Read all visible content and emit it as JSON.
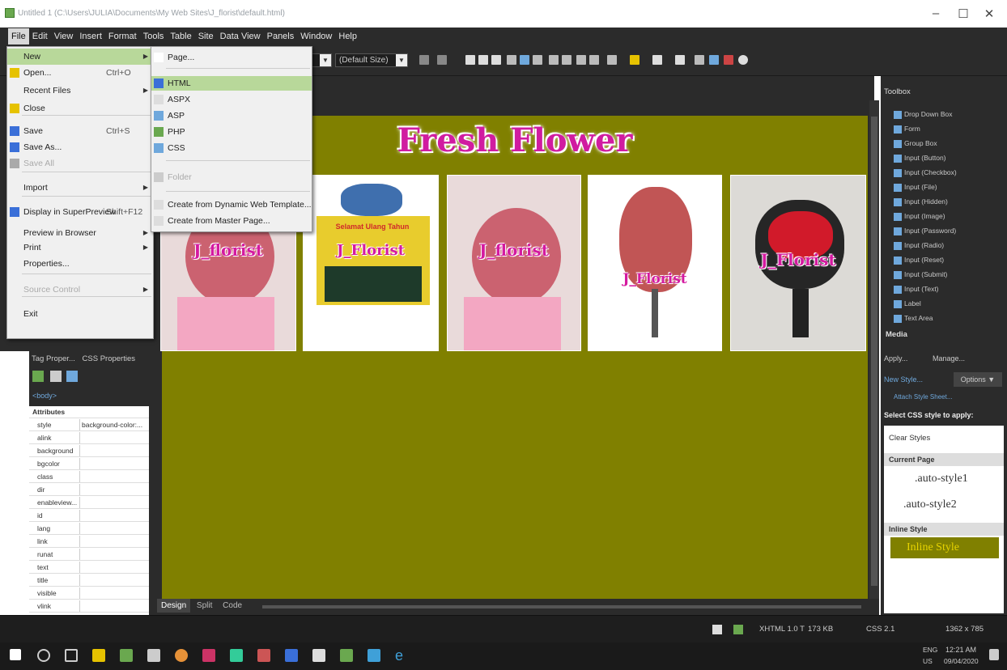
{
  "window": {
    "title": "Untitled 1 (C:\\Users\\JULIA\\Documents\\My Web Sites\\J_florist\\default.html)",
    "controls": [
      "–",
      "☐",
      "✕"
    ]
  },
  "menubar": [
    "File",
    "Edit",
    "View",
    "Insert",
    "Format",
    "Tools",
    "Table",
    "Site",
    "Data View",
    "Panels",
    "Window",
    "Help"
  ],
  "toolbar": {
    "font_size_select": "(Default Size)"
  },
  "file_menu": [
    {
      "label": "New",
      "shortcut": "",
      "submenu": true,
      "highlighted": true
    },
    {
      "label": "Open...",
      "shortcut": "Ctrl+O"
    },
    {
      "label": "Recent Files",
      "shortcut": "",
      "submenu": true
    },
    {
      "label": "Close",
      "shortcut": ""
    },
    {
      "label": "Save",
      "shortcut": "Ctrl+S"
    },
    {
      "label": "Save As...",
      "shortcut": ""
    },
    {
      "label": "Save All",
      "shortcut": "",
      "disabled": true
    },
    {
      "label": "Import",
      "shortcut": "",
      "submenu": true
    },
    {
      "label": "Display in SuperPreview",
      "shortcut": "Shift+F12"
    },
    {
      "label": "Preview in Browser",
      "shortcut": "",
      "submenu": true
    },
    {
      "label": "Print",
      "shortcut": "",
      "submenu": true
    },
    {
      "label": "Properties...",
      "shortcut": ""
    },
    {
      "label": "Source Control",
      "shortcut": "",
      "submenu": true,
      "disabled": true
    },
    {
      "label": "Exit",
      "shortcut": ""
    }
  ],
  "new_submenu": [
    {
      "label": "Page..."
    },
    {
      "label": "HTML",
      "highlighted": true
    },
    {
      "label": "ASPX"
    },
    {
      "label": "ASP"
    },
    {
      "label": "PHP"
    },
    {
      "label": "CSS"
    },
    {
      "label": "Folder",
      "disabled": true
    },
    {
      "label": "Create from Dynamic Web Template..."
    },
    {
      "label": "Create from Master Page..."
    }
  ],
  "design": {
    "heading": "Fresh Flower",
    "background_color": "#808000",
    "photos": [
      {
        "watermark": "J_florist"
      },
      {
        "watermark": "J_Florist",
        "banner": "Selamat Ulang Tahun"
      },
      {
        "watermark": "J_florist"
      },
      {
        "watermark": "J_Florist"
      },
      {
        "watermark": "J_Florist"
      }
    ]
  },
  "view_tabs": [
    "Design",
    "Split",
    "Code"
  ],
  "tag_panel": {
    "tabs": [
      "Tag Proper...",
      "CSS Properties"
    ],
    "tag": "<body>",
    "section": "Attributes",
    "rows": [
      {
        "name": "style",
        "value": "background-color:..."
      },
      {
        "name": "alink",
        "value": ""
      },
      {
        "name": "background",
        "value": ""
      },
      {
        "name": "bgcolor",
        "value": ""
      },
      {
        "name": "class",
        "value": ""
      },
      {
        "name": "dir",
        "value": ""
      },
      {
        "name": "enableview...",
        "value": ""
      },
      {
        "name": "id",
        "value": ""
      },
      {
        "name": "lang",
        "value": ""
      },
      {
        "name": "link",
        "value": ""
      },
      {
        "name": "runat",
        "value": ""
      },
      {
        "name": "text",
        "value": ""
      },
      {
        "name": "title",
        "value": ""
      },
      {
        "name": "visible",
        "value": ""
      },
      {
        "name": "vlink",
        "value": ""
      }
    ]
  },
  "toolbox": {
    "title": "Toolbox",
    "items": [
      "Drop Down Box",
      "Form",
      "Group Box",
      "Input (Button)",
      "Input (Checkbox)",
      "Input (File)",
      "Input (Hidden)",
      "Input (Image)",
      "Input (Password)",
      "Input (Radio)",
      "Input (Reset)",
      "Input (Submit)",
      "Input (Text)",
      "Label",
      "Text Area"
    ],
    "section": "Media"
  },
  "apply_styles": {
    "tabs": [
      "Apply...",
      "Manage..."
    ],
    "new_style": "New Style...",
    "options": "Options ▼",
    "attach": "Attach Style Sheet...",
    "select_label": "Select CSS style to apply:",
    "clear": "Clear Styles",
    "current_page": "Current Page",
    "styles": [
      ".auto-style1",
      ".auto-style2"
    ],
    "inline_section": "Inline Style",
    "inline": "Inline Style"
  },
  "statusbar": {
    "doctype": "XHTML 1.0 T",
    "size": "173 KB",
    "css": "CSS 2.1",
    "dimensions": "1362 x 785"
  },
  "taskbar": {
    "lang": "ENG",
    "region": "US",
    "time": "12:21 AM",
    "date": "09/04/2020"
  }
}
